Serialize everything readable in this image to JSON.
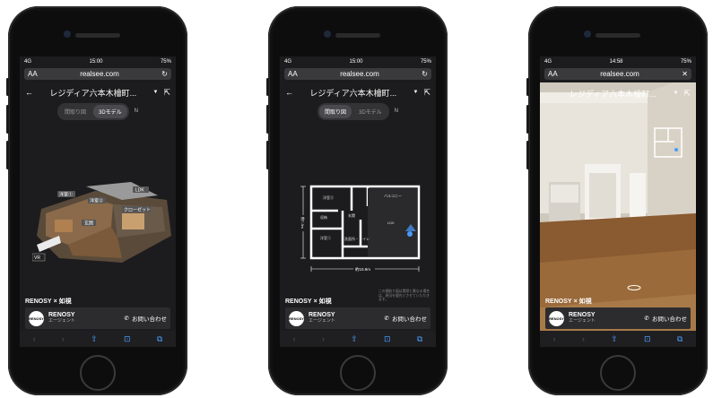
{
  "status_bar": {
    "left": [
      "4G",
      "4G",
      "4G"
    ],
    "time": [
      "15:00",
      "15:00",
      "14:58"
    ],
    "battery": [
      "75%",
      "75%",
      "75%"
    ]
  },
  "browser": {
    "text_size": "AA",
    "url": "realsee.com"
  },
  "app": {
    "title": "レジディア六本木檜町...",
    "modes": {
      "floorplan": "間取り図",
      "model3d": "3Dモデル"
    },
    "compass": "N"
  },
  "model_labels": [
    "洋室①",
    "洋室②",
    "LDK",
    "クローゼット",
    "玄関",
    "VR"
  ],
  "floorplan": {
    "rooms": [
      "洋室②",
      "バルコニー",
      "LDK",
      "洋室①",
      "玄関",
      "収納",
      "洗面所・トイレ"
    ],
    "dim_width": "約10.9m",
    "dim_height": "約7.3m",
    "note": "この間取り図は実際と異なる場合は、現況を優先とさせていただきます。"
  },
  "brand": {
    "renosy": "RENOSY",
    "x": "×",
    "partner": "如視"
  },
  "contact": {
    "logo": "RENOSY",
    "name": "RENOSY",
    "role": "エージェント",
    "call_label": "お問い合わせ"
  },
  "colors": {
    "screen_bg": "#1c1c1e",
    "accent": "#4a9bff",
    "phone": "#0d0d0d"
  }
}
